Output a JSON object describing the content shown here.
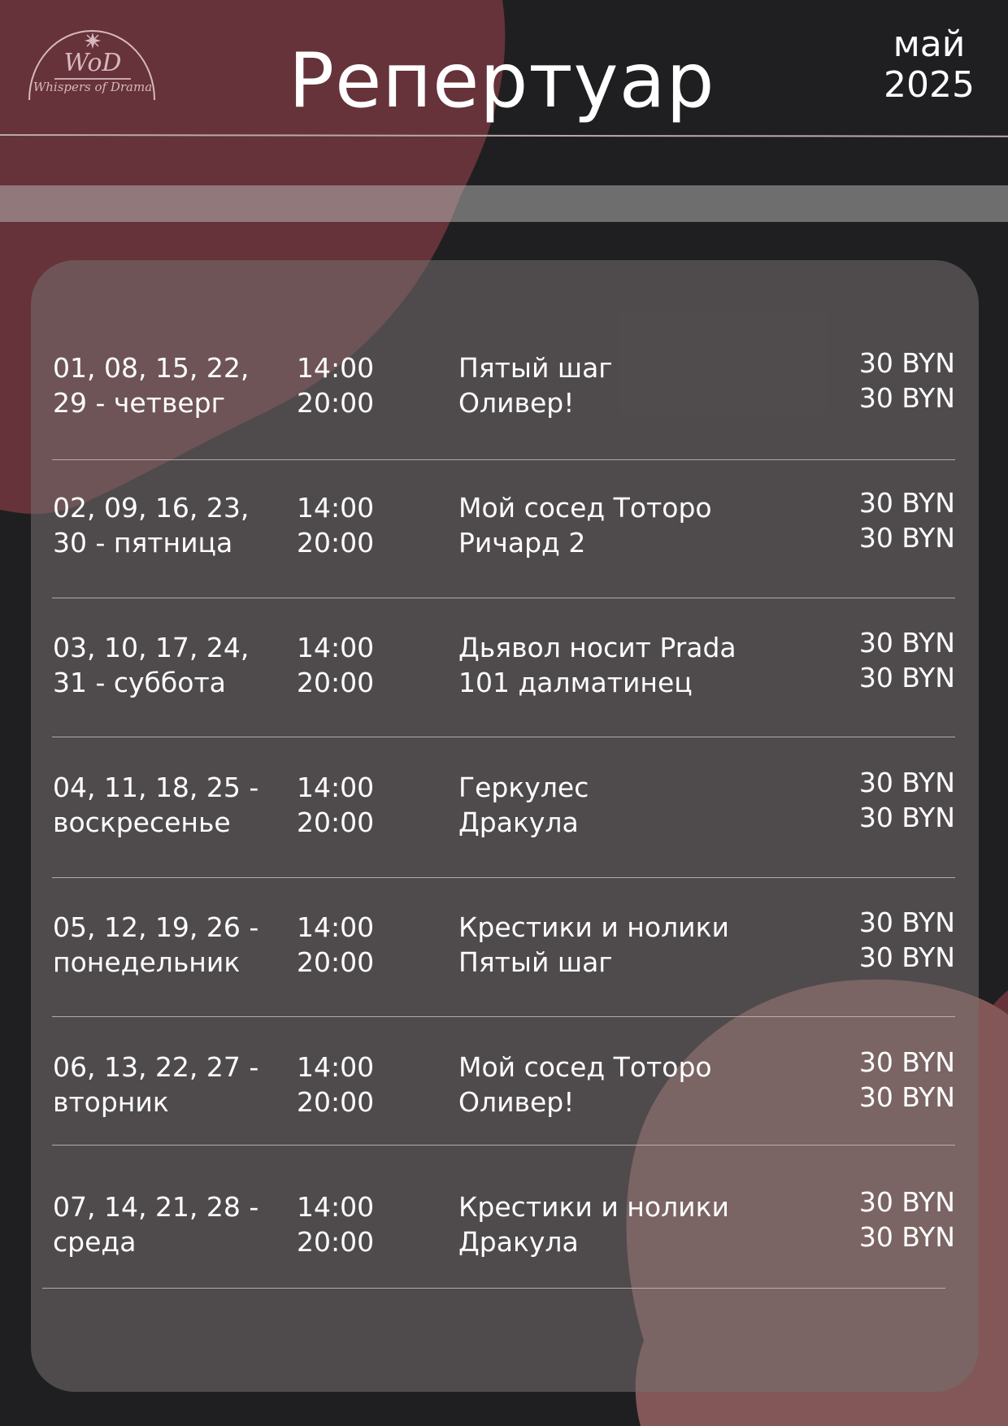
{
  "logo": {
    "monogram": "WoD",
    "text": "Whispers of Drama",
    "icon": "star-icon"
  },
  "header": {
    "title": "Репертуар",
    "month": "май",
    "year": "2025"
  },
  "colors": {
    "background": "#1f1f21",
    "accent_wine": "#653339",
    "accent_rose": "#835758",
    "card": "#514848",
    "text": "#ffffff",
    "logo": "#d9b7be"
  },
  "schedule": {
    "rows": [
      {
        "days_line1": "01, 08, 15, 22,",
        "days_line2": "29 - четверг",
        "time_1": "14:00",
        "time_2": "20:00",
        "show_1": "Пятый шаг",
        "show_2": "Оливер!",
        "price_1": "30 BYN",
        "price_2": "30 BYN"
      },
      {
        "days_line1": "02, 09, 16, 23,",
        "days_line2": "30 - пятница",
        "time_1": "14:00",
        "time_2": "20:00",
        "show_1": "Мой сосед Тоторо",
        "show_2": "Ричард 2",
        "price_1": "30 BYN",
        "price_2": "30 BYN"
      },
      {
        "days_line1": "03, 10, 17, 24,",
        "days_line2": "31 - суббота",
        "time_1": "14:00",
        "time_2": "20:00",
        "show_1": "Дьявол носит Prada",
        "show_2": "101 далматинец",
        "price_1": "30 BYN",
        "price_2": "30 BYN"
      },
      {
        "days_line1": "04, 11, 18, 25 -",
        "days_line2": "воскресенье",
        "time_1": "14:00",
        "time_2": "20:00",
        "show_1": "Геркулес",
        "show_2": "Дракула",
        "price_1": "30 BYN",
        "price_2": "30 BYN"
      },
      {
        "days_line1": "05, 12, 19, 26 -",
        "days_line2": "понедельник",
        "time_1": "14:00",
        "time_2": "20:00",
        "show_1": "Крестики и нолики",
        "show_2": "Пятый шаг",
        "price_1": "30 BYN",
        "price_2": "30 BYN"
      },
      {
        "days_line1": "06, 13, 22, 27 -",
        "days_line2": "вторник",
        "time_1": "14:00",
        "time_2": "20:00",
        "show_1": "Мой сосед Тоторо",
        "show_2": "Оливер!",
        "price_1": "30 BYN",
        "price_2": "30 BYN"
      },
      {
        "days_line1": "07, 14, 21, 28 -",
        "days_line2": "среда",
        "time_1": "14:00",
        "time_2": "20:00",
        "show_1": "Крестики и нолики",
        "show_2": "Дракула",
        "price_1": "30 BYN",
        "price_2": "30 BYN"
      }
    ]
  }
}
